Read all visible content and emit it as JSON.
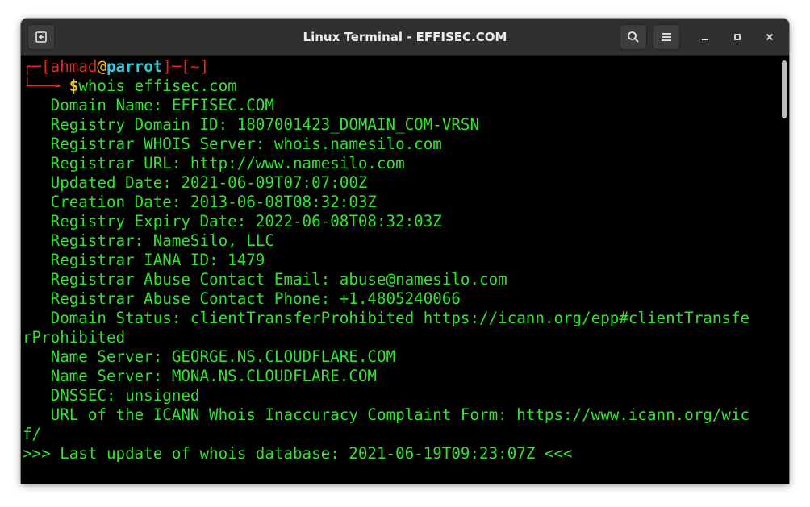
{
  "window": {
    "title": "Linux Terminal - EFFISEC.COM"
  },
  "titlebar": {
    "new_tab_icon": "new-tab-icon",
    "search_icon": "search-icon",
    "menu_icon": "hamburger-menu-icon",
    "minimize_icon": "minimize-icon",
    "maximize_icon": "maximize-icon",
    "close_icon": "close-icon"
  },
  "prompt": {
    "open_bracket": "┌─[",
    "user": "ahmad",
    "at": "@",
    "host": "parrot",
    "mid": "]─[",
    "path": "~",
    "close_bracket": "]",
    "corner": "└──╼ ",
    "dollar": "$",
    "command": "whois effisec.com"
  },
  "output": {
    "lines": [
      "   Domain Name: EFFISEC.COM",
      "   Registry Domain ID: 1807001423_DOMAIN_COM-VRSN",
      "   Registrar WHOIS Server: whois.namesilo.com",
      "   Registrar URL: http://www.namesilo.com",
      "   Updated Date: 2021-06-09T07:07:00Z",
      "   Creation Date: 2013-06-08T08:32:03Z",
      "   Registry Expiry Date: 2022-06-08T08:32:03Z",
      "   Registrar: NameSilo, LLC",
      "   Registrar IANA ID: 1479",
      "   Registrar Abuse Contact Email: abuse@namesilo.com",
      "   Registrar Abuse Contact Phone: +1.4805240066",
      "   Domain Status: clientTransferProhibited https://icann.org/epp#clientTransfe",
      "rProhibited",
      "   Name Server: GEORGE.NS.CLOUDFLARE.COM",
      "   Name Server: MONA.NS.CLOUDFLARE.COM",
      "   DNSSEC: unsigned",
      "   URL of the ICANN Whois Inaccuracy Complaint Form: https://www.icann.org/wic",
      "f/",
      ">>> Last update of whois database: 2021-06-19T09:23:07Z <<<"
    ]
  },
  "colors": {
    "terminal_bg": "#000000",
    "output_green": "#2ee62e",
    "prompt_red": "#e02828",
    "host_cyan": "#35c9d8",
    "accent_yellow": "#f5c200",
    "titlebar_bg": "#303030"
  }
}
